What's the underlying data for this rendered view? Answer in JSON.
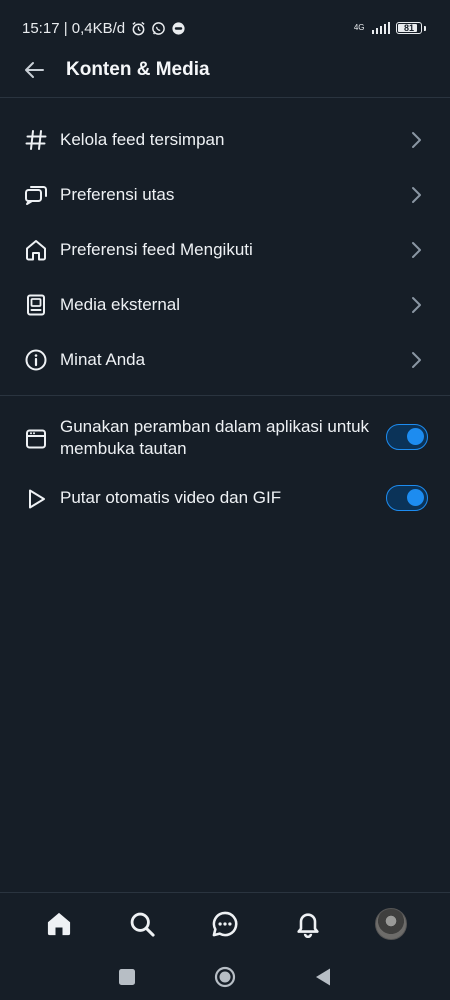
{
  "statusbar": {
    "time_speed": "15:17 | 0,4KB/d",
    "network": "4G",
    "battery": "81",
    "icons": [
      "alarm-icon",
      "whatsapp-icon",
      "messenger-icon"
    ]
  },
  "header": {
    "title": "Konten & Media",
    "back_icon": "arrow-left-icon"
  },
  "menu": [
    {
      "label": "Kelola feed tersimpan",
      "icon": "hashtag-icon"
    },
    {
      "label": "Preferensi utas",
      "icon": "chat-bubbles-icon"
    },
    {
      "label": "Preferensi feed Mengikuti",
      "icon": "home-outline-icon"
    },
    {
      "label": "Media eksternal",
      "icon": "media-card-icon"
    },
    {
      "label": "Minat Anda",
      "icon": "info-circle-icon"
    }
  ],
  "toggles": [
    {
      "label": "Gunakan peramban dalam aplikasi untuk membuka tautan",
      "icon": "browser-window-icon",
      "on": true
    },
    {
      "label": "Putar otomatis video dan GIF",
      "icon": "play-icon",
      "on": true
    }
  ],
  "bottom_nav": [
    "home-icon",
    "search-icon",
    "chat-icon",
    "bell-icon",
    "avatar"
  ],
  "system_nav": [
    "recents-square-icon",
    "home-circle-icon",
    "back-triangle-icon"
  ],
  "colors": {
    "background": "#161e27",
    "accent": "#1d8cf0",
    "text": "#eef1f4",
    "divider": "#2a343f"
  }
}
